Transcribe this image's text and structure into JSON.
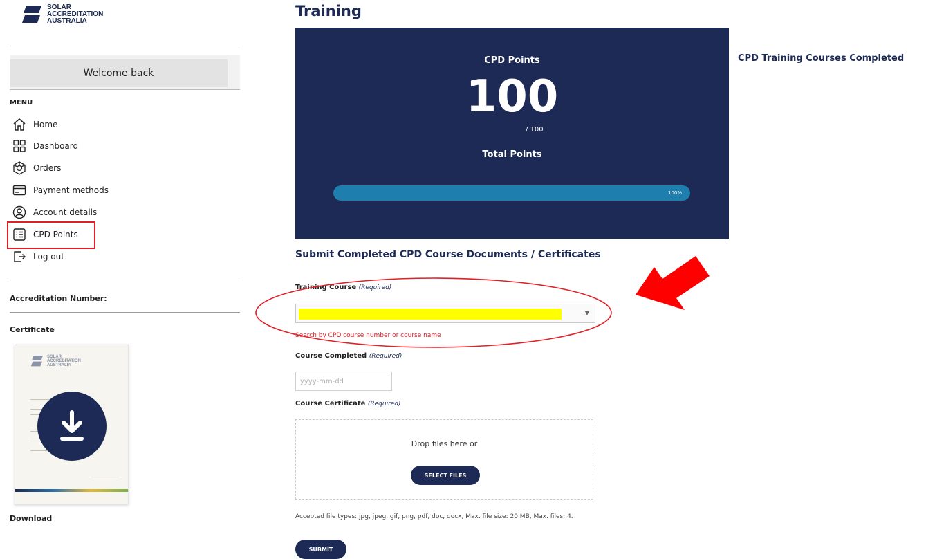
{
  "sidebar": {
    "logo_lines": [
      "SOLAR",
      "ACCREDITATION",
      "AUSTRALIA"
    ],
    "welcome": "Welcome back",
    "menu_title": "MENU",
    "items": [
      {
        "label": "Home",
        "icon": "home-icon"
      },
      {
        "label": "Dashboard",
        "icon": "dashboard-icon"
      },
      {
        "label": "Orders",
        "icon": "orders-icon"
      },
      {
        "label": "Payment methods",
        "icon": "card-icon"
      },
      {
        "label": "Account details",
        "icon": "user-icon"
      },
      {
        "label": "CPD Points",
        "icon": "list-icon",
        "selected": true
      },
      {
        "label": "Log out",
        "icon": "logout-icon"
      }
    ],
    "accreditation_label": "Accreditation Number:",
    "certificate_label": "Certificate",
    "certificate_logo_lines": [
      "SOLAR",
      "ACCREDITATION",
      "AUSTRALIA"
    ],
    "download_label": "Download"
  },
  "main": {
    "title": "Training",
    "cpd": {
      "label": "CPD Points",
      "value": "100",
      "max": "/ 100",
      "total_label": "Total Points",
      "progress_percent": 100,
      "progress_label": "100%"
    },
    "completed_heading": "CPD Training Courses Completed",
    "form": {
      "heading": "Submit Completed CPD Course Documents / Certificates",
      "training_course_label": "Training Course",
      "required": "(Required)",
      "training_course_hint": "Search by CPD course number or course name",
      "course_completed_label": "Course Completed",
      "date_placeholder": "yyyy-mm-dd",
      "course_certificate_label": "Course Certificate",
      "drop_text": "Drop files here or",
      "select_files": "SELECT FILES",
      "accepted": "Accepted file types: jpg, jpeg, gif, png, pdf, doc, docx, Max. file size: 20 MB, Max. files: 4.",
      "submit": "SUBMIT"
    }
  },
  "colors": {
    "navy": "#1c2a55",
    "progress": "#1e7fae",
    "highlight_red": "#e21f26",
    "highlight_yellow": "#ffff00"
  }
}
